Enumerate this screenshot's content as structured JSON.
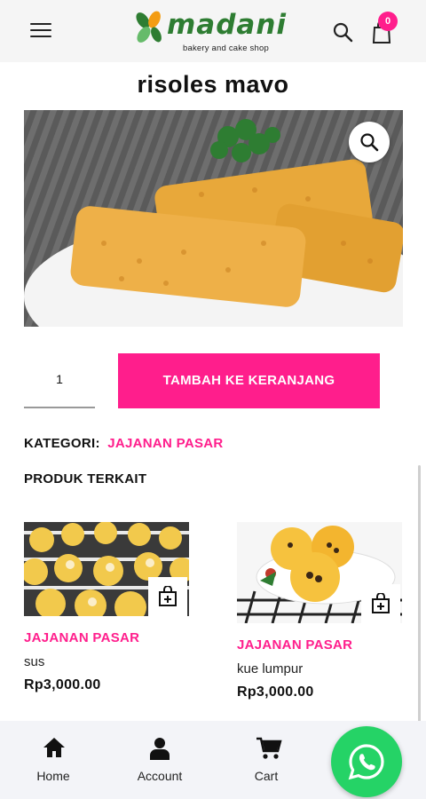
{
  "header": {
    "brand_name": "madani",
    "brand_tagline": "bakery and cake shop",
    "cart_count": "0",
    "icons": [
      "menu-icon",
      "search-icon",
      "cart-icon"
    ]
  },
  "product": {
    "title": "risoles mavo",
    "quantity": "1",
    "add_to_cart_label": "TAMBAH KE KERANJANG",
    "category_label": "KATEGORI:",
    "category_value": "JAJANAN PASAR"
  },
  "related": {
    "title": "PRODUK TERKAIT",
    "items": [
      {
        "category": "JAJANAN PASAR",
        "name": "sus",
        "price": "Rp3,000.00"
      },
      {
        "category": "JAJANAN PASAR",
        "name": "kue lumpur",
        "price": "Rp3,000.00"
      }
    ]
  },
  "bottom_nav": {
    "items": [
      {
        "label": "Home",
        "icon": "home-icon"
      },
      {
        "label": "Account",
        "icon": "user-icon"
      },
      {
        "label": "Cart",
        "icon": "cart-icon"
      }
    ]
  },
  "colors": {
    "accent": "#ff1e8c",
    "brand_green": "#2e7d32",
    "whatsapp": "#25d366",
    "header_bg": "#f5f5f5"
  }
}
